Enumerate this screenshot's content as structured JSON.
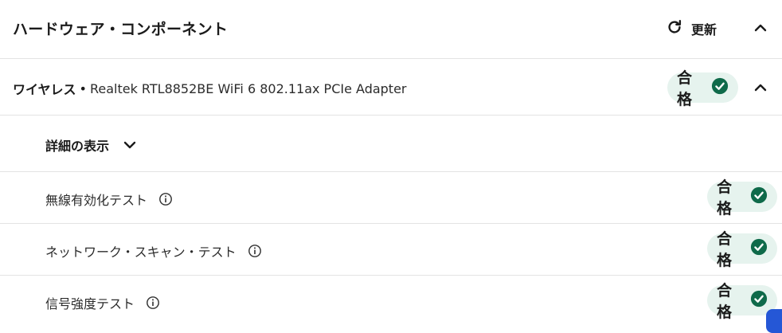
{
  "section": {
    "title": "ハードウェア・コンポーネント",
    "refresh_label": "更新",
    "refresh_icon": "refresh-icon",
    "collapse_icon": "chevron-up-icon"
  },
  "wireless": {
    "category": "ワイヤレス",
    "separator": "•",
    "device": "Realtek RTL8852BE WiFi 6 802.11ax PCIe Adapter",
    "status": "合格",
    "status_icon": "check-circle-icon"
  },
  "details": {
    "label": "詳細の表示",
    "icon": "chevron-down-icon"
  },
  "tests": [
    {
      "name": "無線有効化テスト",
      "status": "合格"
    },
    {
      "name": "ネットワーク・スキャン・テスト",
      "status": "合格"
    },
    {
      "name": "信号強度テスト",
      "status": "合格"
    }
  ],
  "colors": {
    "pass_bg": "#e6f3ee",
    "pass_icon": "#0f6a4a",
    "divider": "#e3e3e3",
    "accent_blue": "#2557d6"
  }
}
